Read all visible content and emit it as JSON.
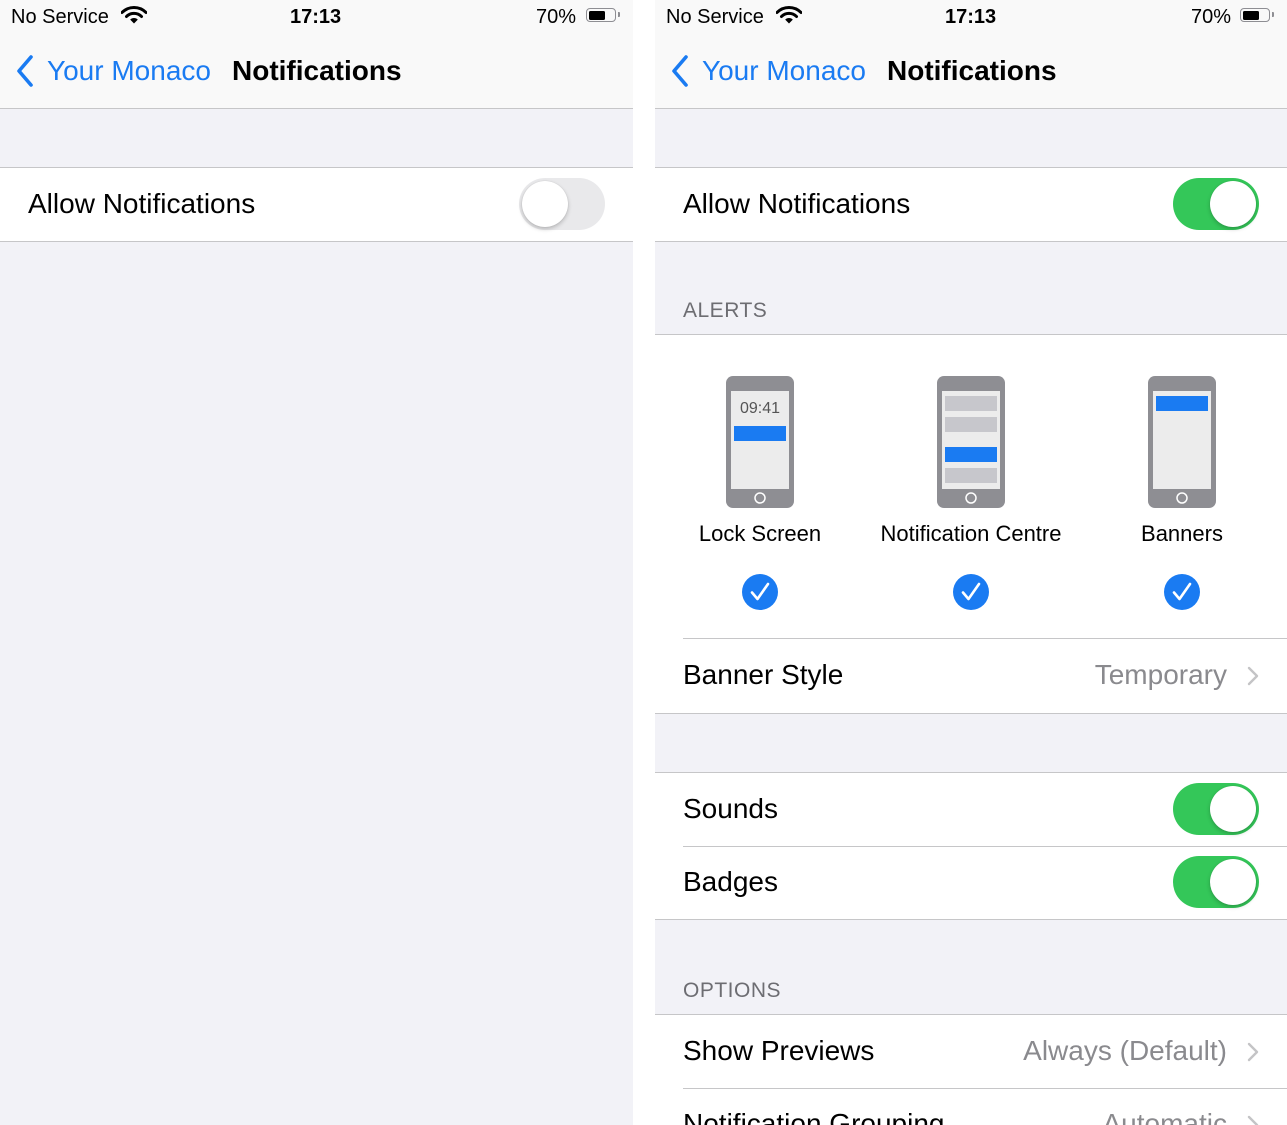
{
  "status_bar": {
    "carrier": "No Service",
    "time": "17:13",
    "battery_percent": "70%",
    "battery_level": 0.7
  },
  "nav": {
    "back_label": "Your Monaco",
    "title": "Notifications"
  },
  "left_screen": {
    "allow_notifications": {
      "label": "Allow Notifications",
      "enabled": false
    }
  },
  "right_screen": {
    "allow_notifications": {
      "label": "Allow Notifications",
      "enabled": true
    },
    "alerts": {
      "header": "ALERTS",
      "items": [
        {
          "label": "Lock Screen",
          "preview_time": "09:41",
          "checked": true
        },
        {
          "label": "Notification Centre",
          "checked": true
        },
        {
          "label": "Banners",
          "checked": true
        }
      ],
      "banner_style": {
        "label": "Banner Style",
        "value": "Temporary"
      }
    },
    "sounds": {
      "label": "Sounds",
      "enabled": true
    },
    "badges": {
      "label": "Badges",
      "enabled": true
    },
    "options": {
      "header": "OPTIONS",
      "show_previews": {
        "label": "Show Previews",
        "value": "Always (Default)"
      },
      "notification_grouping": {
        "label": "Notification Grouping",
        "value": "Automatic"
      }
    }
  },
  "colors": {
    "accent": "#1a7bf2",
    "toggle_on": "#34c759",
    "toggle_off": "#e9e9eb",
    "background": "#f2f2f7"
  }
}
